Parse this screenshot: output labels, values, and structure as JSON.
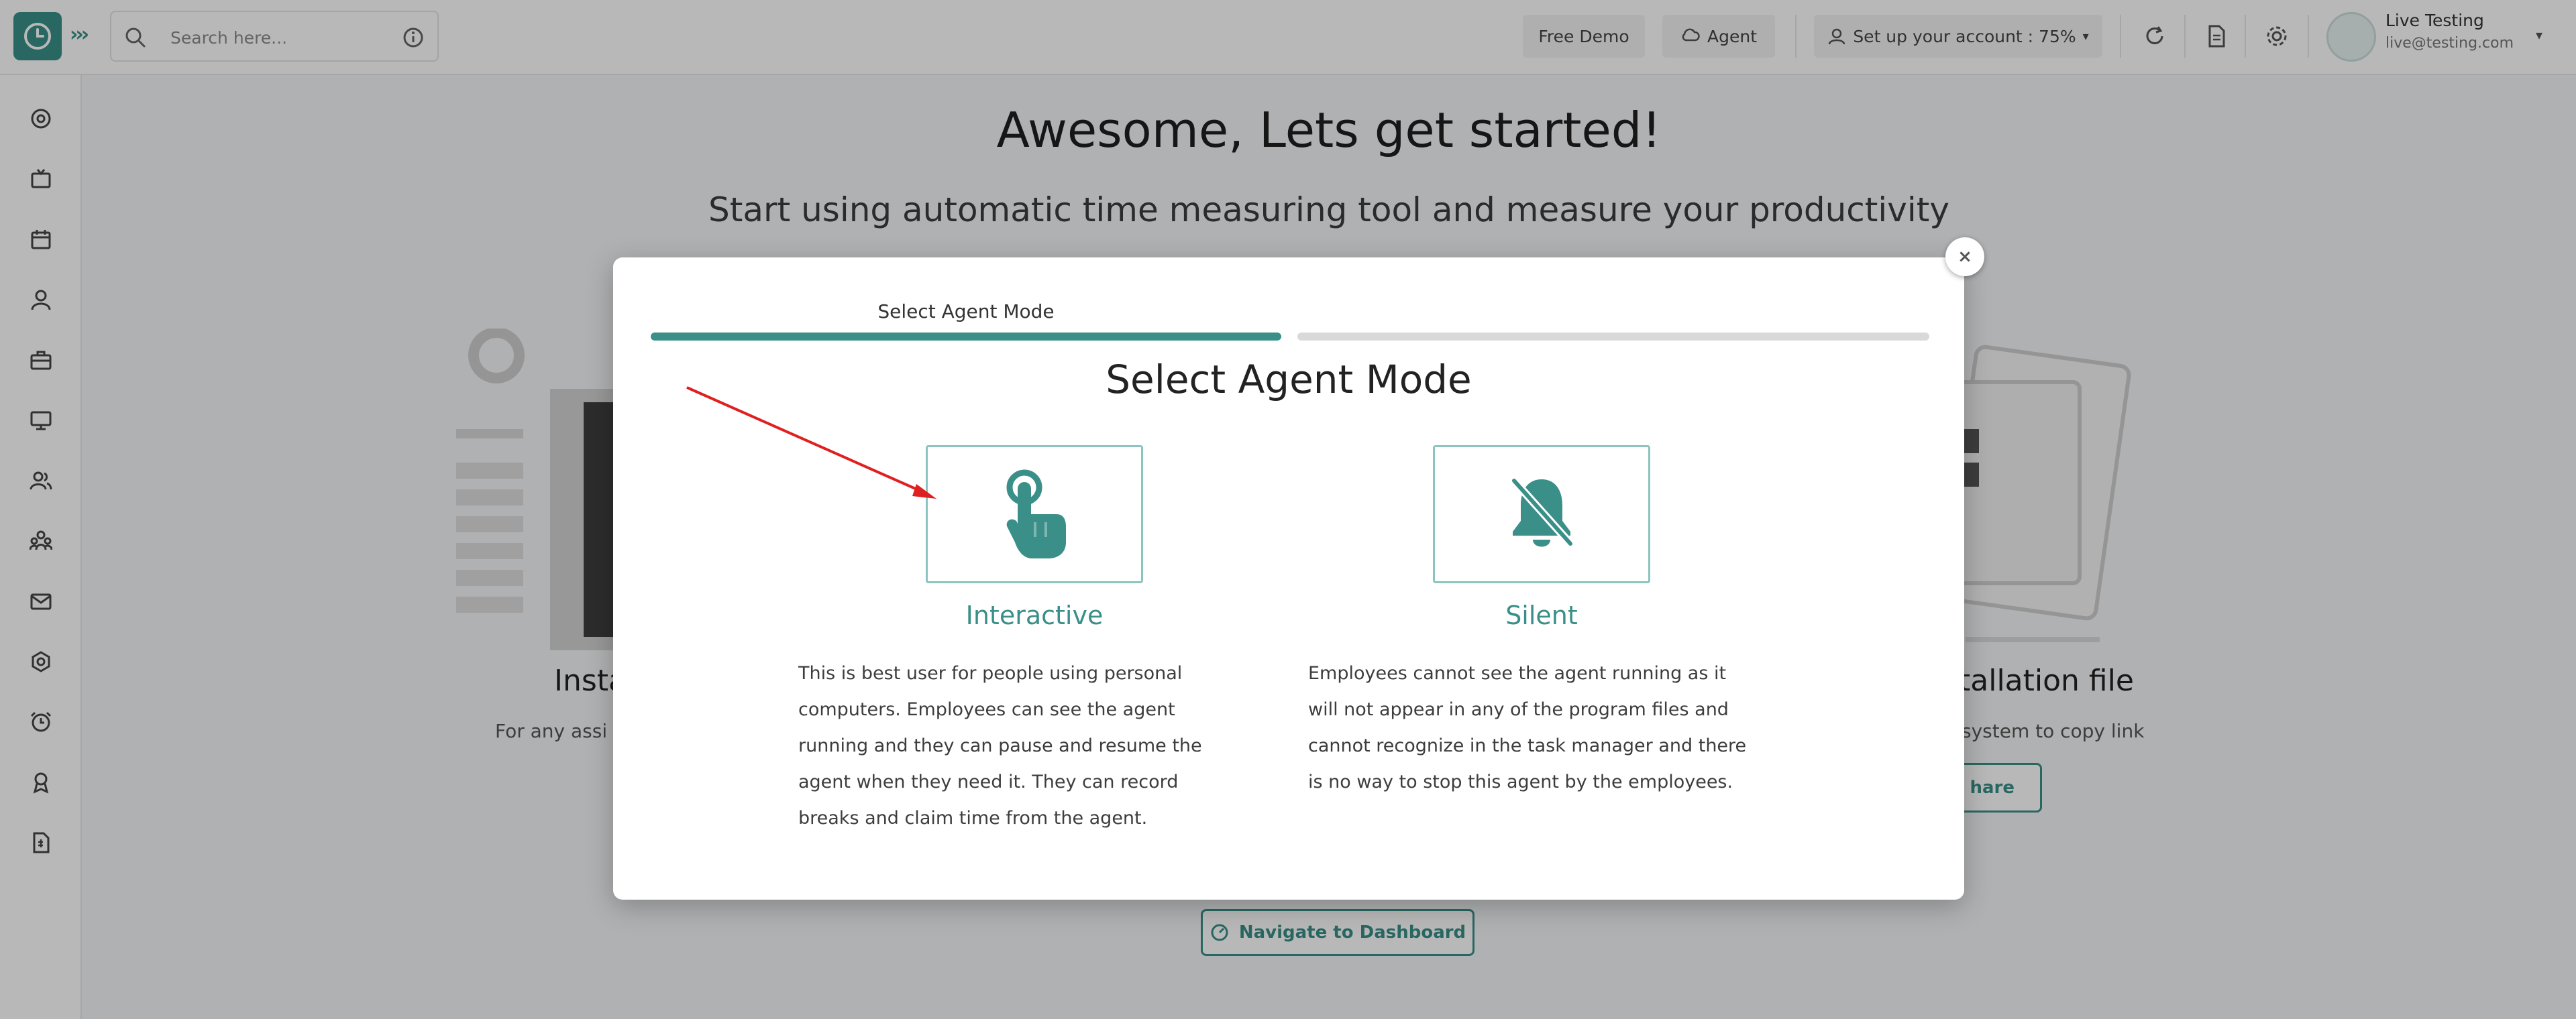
{
  "topbar": {
    "search_placeholder": "Search here...",
    "free_demo": "Free Demo",
    "agent": "Agent",
    "setup": "Set up your account : 75%",
    "user_name": "Live Testing",
    "user_email": "live@testing.com"
  },
  "sidebar": {
    "icons": [
      "dashboard-icon",
      "tv-icon",
      "calendar-icon",
      "user-icon",
      "briefcase-icon",
      "monitor-icon",
      "users-icon",
      "team-icon",
      "mail-icon",
      "settings-icon",
      "alarm-icon",
      "award-icon",
      "report-icon"
    ]
  },
  "background": {
    "title": "Awesome, Lets get started!",
    "subtitle": "Start using automatic time measuring tool and measure your productivity",
    "left_heading": "Insta",
    "left_text": "For any assi",
    "right_heading": "tallation file",
    "right_text": "system to copy link",
    "share_label": "hare",
    "navigate_label": "Navigate to Dashboard"
  },
  "modal": {
    "close_label": "×",
    "step_label": "Select Agent Mode",
    "title": "Select Agent Mode",
    "modes": [
      {
        "label": "Interactive",
        "description": "This is best user for people using personal computers. Employees can see the agent running and they can pause and resume the agent when they need it. They can record breaks and claim time from the agent."
      },
      {
        "label": "Silent",
        "description": "Employees cannot see the agent running as it will not appear in any of the program files and cannot recognize in the task manager and there is no way to stop this agent by the employees."
      }
    ]
  },
  "colors": {
    "accent": "#3a8f88",
    "annotation_arrow": "#e02020"
  }
}
